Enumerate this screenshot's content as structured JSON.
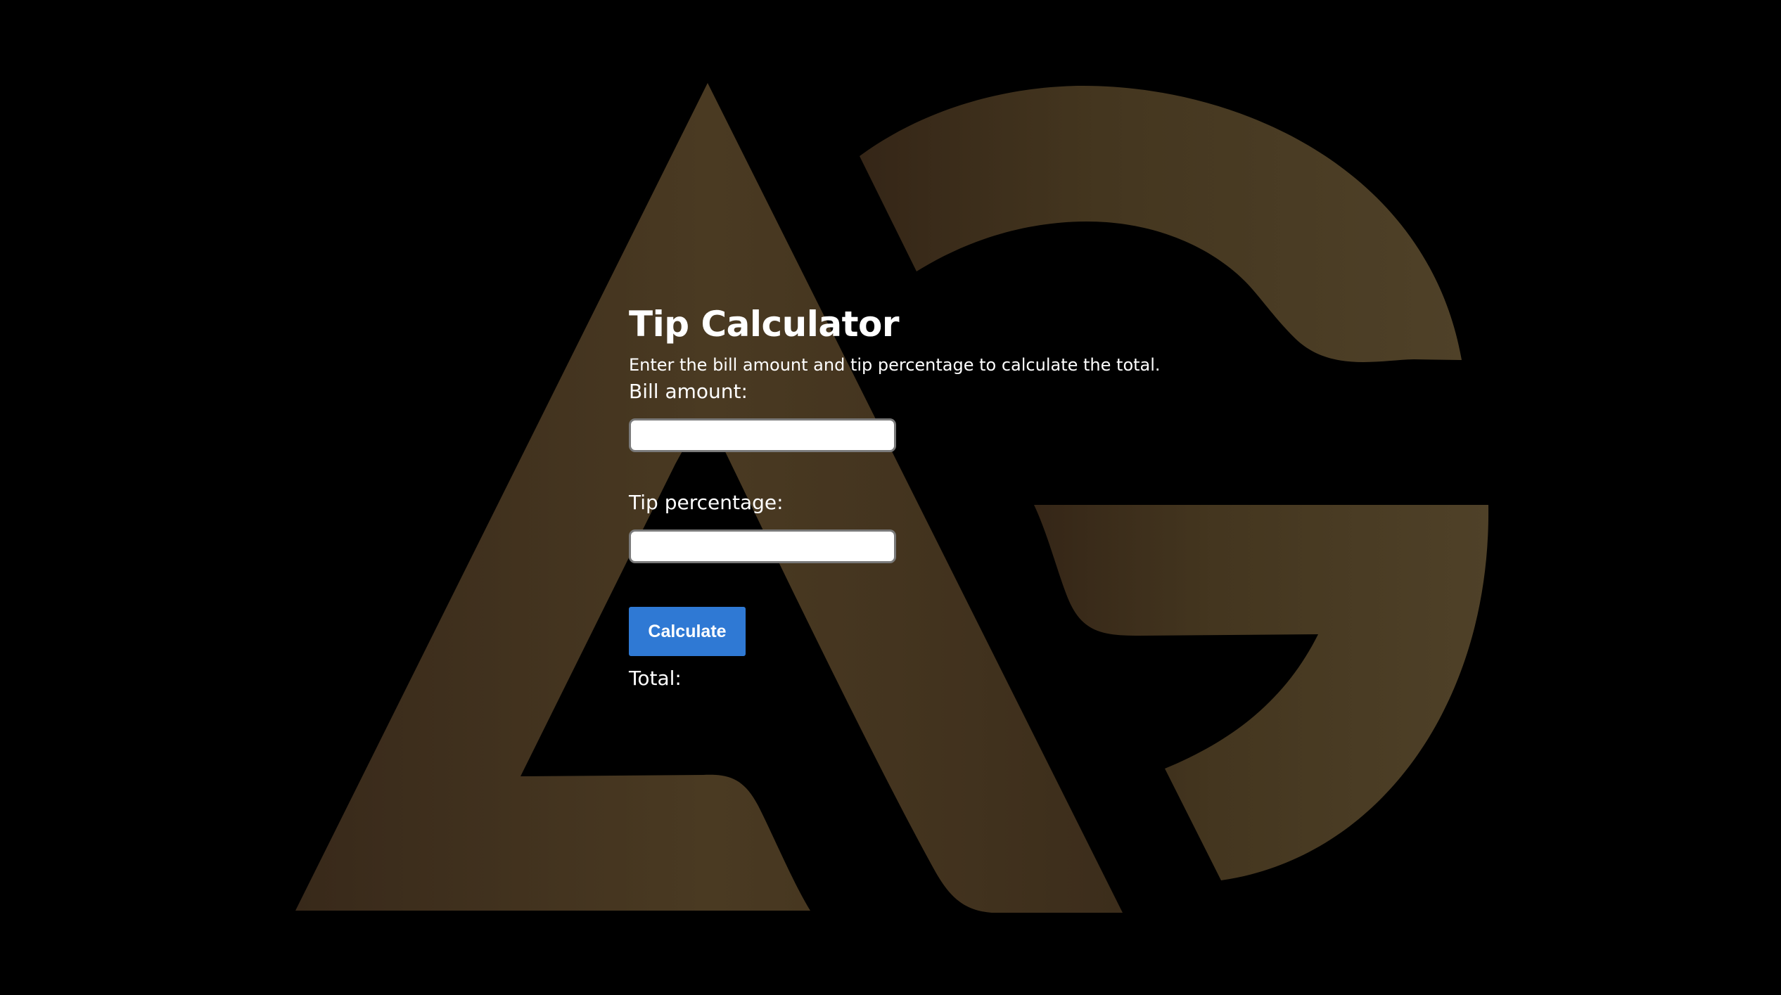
{
  "logo": {
    "icon": "ag-monogram-logo",
    "text": "AG",
    "color_dark": "#3a2a18",
    "color_light": "#4c3d24"
  },
  "calculator": {
    "title": "Tip Calculator",
    "description": "Enter the bill amount and tip percentage to calculate the total.",
    "bill_label": "Bill amount:",
    "bill_value": "",
    "tip_label": "Tip percentage:",
    "tip_value": "",
    "button_label": "Calculate",
    "total_label": "Total:",
    "total_value": ""
  },
  "colors": {
    "background": "#000000",
    "text": "#ffffff",
    "button": "#2f79d4"
  }
}
